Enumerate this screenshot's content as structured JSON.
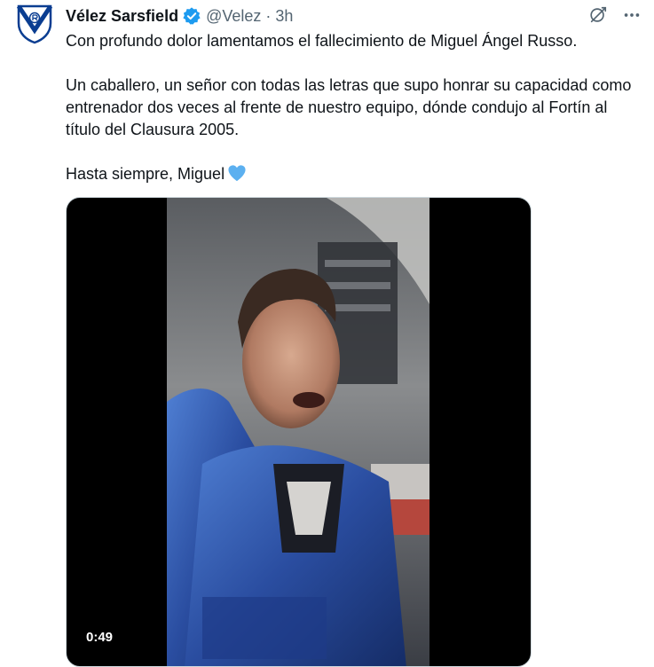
{
  "author": {
    "name": "Vélez Sarsfield",
    "handle": "@Velez",
    "separator": "·",
    "time": "3h",
    "avatar_icon": "velez-shield-logo",
    "verified_icon": "verified-badge-icon"
  },
  "actions": {
    "grok_icon": "grok-icon",
    "more_icon": "more-options-icon"
  },
  "tweet": {
    "line1": "Con profundo dolor lamentamos el fallecimiento de Miguel Ángel Russo.",
    "line2": "Un caballero, un señor con todas las letras que supo honrar su capacidad como entrenador dos veces al frente de nuestro equipo, dónde condujo al Fortín al título del Clausura 2005.",
    "line3": "Hasta siempre, Miguel",
    "emoji": "blue-heart-icon"
  },
  "media": {
    "type": "video",
    "duration": "0:49"
  },
  "colors": {
    "text": "#0f1419",
    "secondary": "#536471",
    "verified": "#1d9bf0",
    "heart": "#5cb0f0",
    "brand_blue": "#0a3d91"
  }
}
